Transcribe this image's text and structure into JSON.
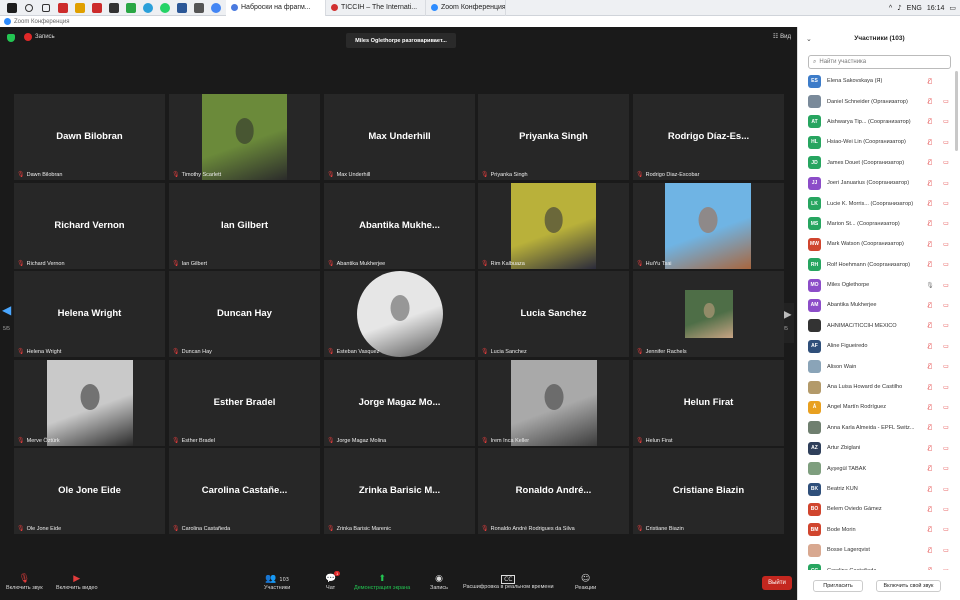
{
  "taskbar": {
    "icons": [
      {
        "name": "windows-start-icon",
        "color": "#1e1e1e"
      },
      {
        "name": "search-icon",
        "color": "#333"
      },
      {
        "name": "task-view-icon",
        "color": "#333"
      },
      {
        "name": "app-icon",
        "color": "#cc2b2b"
      },
      {
        "name": "app-icon",
        "color": "#e0a000"
      },
      {
        "name": "zotero-icon",
        "color": "#cc2b2b"
      },
      {
        "name": "app-icon",
        "color": "#333"
      },
      {
        "name": "app-icon",
        "color": "#2aa745"
      },
      {
        "name": "telegram-icon",
        "color": "#2aa0da"
      },
      {
        "name": "whatsapp-icon",
        "color": "#25d366"
      },
      {
        "name": "word-icon",
        "color": "#2b5797"
      },
      {
        "name": "app-icon",
        "color": "#555"
      },
      {
        "name": "chrome-icon",
        "color": "#4285f4"
      }
    ],
    "tabs": [
      {
        "label": "Наброски на фрагм...",
        "dot": "#4a7adf",
        "active": true
      },
      {
        "label": "TICCIH – The Internati...",
        "dot": "#d03030",
        "active": false
      },
      {
        "label": "Zoom Конференция",
        "dot": "#2d8cff",
        "active": false
      }
    ],
    "tray": {
      "lang": "ENG",
      "time": "16:14",
      "chevron": "^"
    }
  },
  "window": {
    "title": "Zoom Конференция"
  },
  "topbar": {
    "recording": "Запись",
    "speaking": "Miles Oglethorpe разговаривает...",
    "view": "Вид"
  },
  "tiles": [
    {
      "name": "Dawn Bilobran",
      "label": "Dawn Bilobran"
    },
    {
      "name": "",
      "label": "Timothy Scarlett",
      "photo": "#6b8a3a",
      "photo_accent": "#2b2b2b"
    },
    {
      "name": "Max Underhill",
      "label": "Max Underhill"
    },
    {
      "name": "Priyanka Singh",
      "label": "Priyanka Singh"
    },
    {
      "name": "Rodrigo  Díaz-Es...",
      "label": "Rodrigo Diaz-Escobar"
    },
    {
      "name": "Richard Vernon",
      "label": "Richard Vernon"
    },
    {
      "name": "Ian Gilbert",
      "label": "Ian Gilbert"
    },
    {
      "name": "Abantika  Mukhe...",
      "label": "Abantika Mukherjee"
    },
    {
      "name": "",
      "label": "Rim Kalbuaza",
      "photo": "#b9b13a",
      "photo_accent": "#2b2b3b"
    },
    {
      "name": "",
      "label": "HuiYu Tsai",
      "photo": "#6fb4e4",
      "photo_accent": "#a8663e"
    },
    {
      "name": "Helena Wright",
      "label": "Helena Wright"
    },
    {
      "name": "Duncan Hay",
      "label": "Duncan Hay"
    },
    {
      "name": "",
      "label": "Esteban Vasquez",
      "photo": "#e6e6e6",
      "photo_accent": "#555"
    },
    {
      "name": "Lucia Sanchez",
      "label": "Lucia Sanchez"
    },
    {
      "name": "",
      "label": "Jennifer Rachels",
      "photo": "#4e6e47",
      "photo_accent": "#c8a484"
    },
    {
      "name": "",
      "label": "Merve Öztürk",
      "photo": "#c9c9c9",
      "photo_accent": "#2a2a2a"
    },
    {
      "name": "Esther Bradel",
      "label": "Esther Bradel"
    },
    {
      "name": "Jorge Magaz Mo...",
      "label": "Jorge Magaz Molina"
    },
    {
      "name": "",
      "label": "Irem Inca Keller",
      "photo": "#a9a9a9",
      "photo_accent": "#3b3b3b"
    },
    {
      "name": "Helun Firat",
      "label": "Helun Firat"
    },
    {
      "name": "Ole Jone Eide",
      "label": "Ole Jone Eide"
    },
    {
      "name": "Carolina  Castañe...",
      "label": "Carolina Castañeda"
    },
    {
      "name": "Zrinka Barisic M...",
      "label": "Zrinka Barisic Marenic"
    },
    {
      "name": "Ronaldo  André...",
      "label": "Ronaldo André Rodrigues da Silva"
    },
    {
      "name": "Cristiane Biazin",
      "label": "Cristiane Biazin"
    }
  ],
  "pager": {
    "left": "5/5",
    "right": "5/5"
  },
  "toolbar": {
    "mic": "Включить звук",
    "video": "Включить видео",
    "participants": "Участники",
    "participants_count": "103",
    "chat": "Чат",
    "chat_badge": "1",
    "share": "Демонстрация экрана",
    "record": "Запись",
    "transcript": "Расшифровка в реальном времени",
    "cc": "CC",
    "reactions": "Реакции",
    "leave": "Выйти"
  },
  "panel": {
    "title": "Участники (103)",
    "search_placeholder": "Найти участника",
    "participants": [
      {
        "init": "ES",
        "color": "#3d7cc9",
        "name": "Elena Sakovskaya (Я)",
        "mic": "muted",
        "video": "none"
      },
      {
        "init": "",
        "color": "#7a8a9a",
        "name": "Daniel Schneider (Организатор)",
        "mic": "muted",
        "video": "off"
      },
      {
        "init": "AT",
        "color": "#27a560",
        "name": "Aishwarya Tip... (Соорганизатор)",
        "mic": "muted",
        "video": "off"
      },
      {
        "init": "HL",
        "color": "#27a560",
        "name": "Hsiao-Wei Lin (Соорганизатор)",
        "mic": "muted",
        "video": "off"
      },
      {
        "init": "JD",
        "color": "#27a560",
        "name": "James Douet (Соорганизатор)",
        "mic": "muted",
        "video": "off"
      },
      {
        "init": "JJ",
        "color": "#8c4dc8",
        "name": "Joeri Januarius (Соорганизатор)",
        "mic": "muted",
        "video": "off"
      },
      {
        "init": "LK",
        "color": "#27a560",
        "name": "Lucie K. Morris... (Соорганизатор)",
        "mic": "muted",
        "video": "off"
      },
      {
        "init": "MS",
        "color": "#27a560",
        "name": "Marion St... (Соорганизатор)",
        "mic": "muted",
        "video": "off"
      },
      {
        "init": "MW",
        "color": "#d0452e",
        "name": "Mark Watson (Соорганизатор)",
        "mic": "muted",
        "video": "off"
      },
      {
        "init": "RH",
        "color": "#27a560",
        "name": "Rolf Hoehmann (Соорганизатор)",
        "mic": "muted",
        "video": "off"
      },
      {
        "init": "MO",
        "color": "#8c4dc8",
        "name": "Miles Oglethorpe",
        "mic": "on",
        "video": "off"
      },
      {
        "init": "AM",
        "color": "#8c4dc8",
        "name": "Abantika Mukherjee",
        "mic": "muted",
        "video": "off"
      },
      {
        "init": "",
        "color": "#333333",
        "name": "AHNIMAC/TICCIH MÉXICO",
        "mic": "muted",
        "video": "off"
      },
      {
        "init": "AF",
        "color": "#2f4f7a",
        "name": "Aline Figueiredo",
        "mic": "muted",
        "video": "off"
      },
      {
        "init": "",
        "color": "#8aa4b8",
        "name": "Alison Wain",
        "mic": "muted",
        "video": "off"
      },
      {
        "init": "",
        "color": "#b39a6a",
        "name": "Ana Luisa Howard de Castilho",
        "mic": "muted",
        "video": "off"
      },
      {
        "init": "Á",
        "color": "#e8a020",
        "name": "Ángel Martín Rodríguez",
        "mic": "muted",
        "video": "off"
      },
      {
        "init": "",
        "color": "#6f7f6f",
        "name": "Anna Karla Almeida - EPFL Switz...",
        "mic": "muted",
        "video": "off"
      },
      {
        "init": "AZ",
        "color": "#2f3f5a",
        "name": "Artur Zbiglani",
        "mic": "muted",
        "video": "off"
      },
      {
        "init": "",
        "color": "#7e9e7e",
        "name": "Ayşegül TABAK",
        "mic": "muted",
        "video": "off"
      },
      {
        "init": "BK",
        "color": "#2f4f7a",
        "name": "Beatriz KÜN",
        "mic": "muted",
        "video": "off"
      },
      {
        "init": "BO",
        "color": "#d0452e",
        "name": "Belem Oviedo Gámez",
        "mic": "muted",
        "video": "off"
      },
      {
        "init": "BM",
        "color": "#d0452e",
        "name": "Bode Morin",
        "mic": "muted",
        "video": "off"
      },
      {
        "init": "",
        "color": "#d8a890",
        "name": "Bosse Lagerqvist",
        "mic": "muted",
        "video": "off"
      },
      {
        "init": "CC",
        "color": "#27a560",
        "name": "Carolina Castañeda",
        "mic": "muted",
        "video": "off"
      }
    ],
    "invite": "Пригласить",
    "unmute_me": "Включить свой звук"
  }
}
